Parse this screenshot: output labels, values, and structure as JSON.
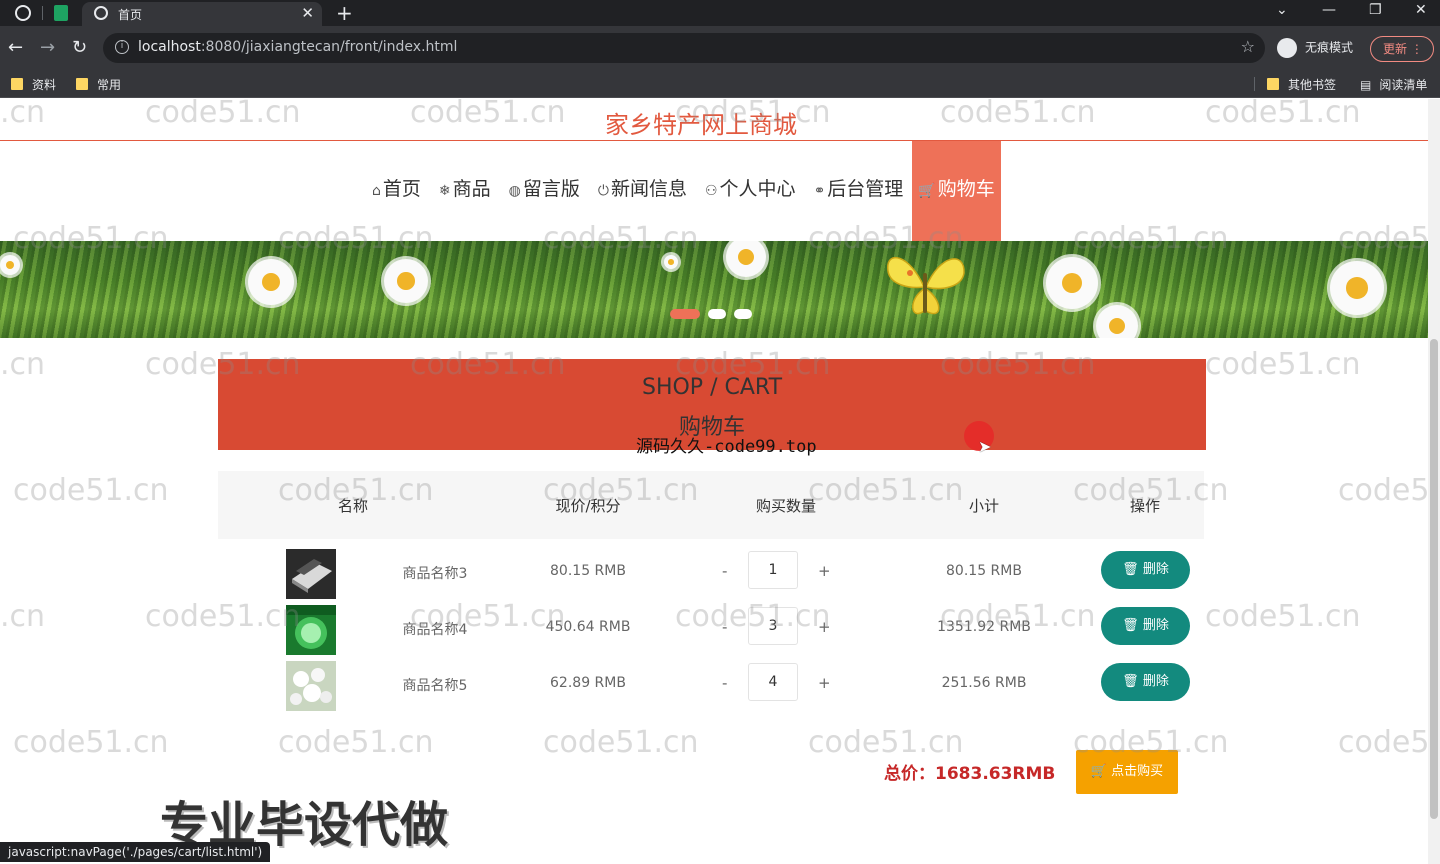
{
  "browser": {
    "tab_title": "首页",
    "url_host": "localhost",
    "url_rest": ":8080/jiaxiangtecan/front/index.html",
    "incognito_label": "无痕模式",
    "update_label": "更新",
    "bookmarks": [
      "资料",
      "常用"
    ],
    "bookmarks_right": [
      "其他书签",
      "阅读清单"
    ],
    "status_text": "javascript:navPage('./pages/cart/list.html')"
  },
  "site": {
    "title": "家乡特产网上商城",
    "nav": [
      {
        "icon": "⌂",
        "label": "首页"
      },
      {
        "icon": "❄",
        "label": "商品"
      },
      {
        "icon": "◍",
        "label": "留言版"
      },
      {
        "icon": "⏻",
        "label": "新闻信息"
      },
      {
        "icon": "⚇",
        "label": "个人中心"
      },
      {
        "icon": "⚭",
        "label": "后台管理"
      },
      {
        "icon": "🛒",
        "label": "购物车"
      }
    ]
  },
  "section": {
    "title_en": "SHOP / CART",
    "title_cn": "购物车"
  },
  "cart": {
    "headers": {
      "name": "名称",
      "price": "现价/积分",
      "qty": "购买数量",
      "subtotal": "小计",
      "action": "操作"
    },
    "items": [
      {
        "name": "商品名称3",
        "price": "80.15 RMB",
        "qty": "1",
        "subtotal": "80.15 RMB",
        "delete_label": "删除",
        "minus": "-",
        "plus": "+"
      },
      {
        "name": "商品名称4",
        "price": "450.64 RMB",
        "qty": "3",
        "subtotal": "1351.92 RMB",
        "delete_label": "删除",
        "minus": "-",
        "plus": "+"
      },
      {
        "name": "商品名称5",
        "price": "62.89 RMB",
        "qty": "4",
        "subtotal": "251.56 RMB",
        "delete_label": "删除",
        "minus": "-",
        "plus": "+"
      }
    ],
    "total_label": "总价：",
    "total_value": "1683.63RMB",
    "buy_label": "点击购买"
  },
  "overlay": {
    "watermark": "code51.cn",
    "watermark_edge": ".cn",
    "watermark_cut": "code5",
    "promo": "专业毕设代做",
    "source": "源码久久-code99.top"
  },
  "colors": {
    "accent": "#e2593f",
    "nav_active": "#ee7158",
    "header_bg": "#d84a33",
    "delete_btn": "#138a7e",
    "buy_btn": "#f5a100",
    "total_text": "#c62828"
  }
}
